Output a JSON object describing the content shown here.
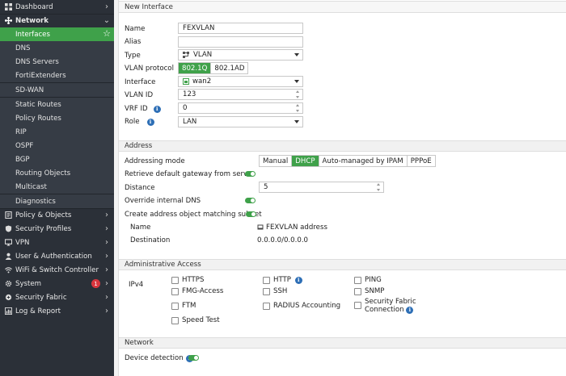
{
  "sidebar": {
    "top_items": [
      {
        "label": "Dashboard",
        "icon": "dashboard-icon"
      },
      {
        "label": "Network",
        "icon": "network-icon"
      }
    ],
    "network_sub": [
      "Interfaces",
      "DNS",
      "DNS Servers",
      "FortiExtenders",
      "SD-WAN",
      "Static Routes",
      "Policy Routes",
      "RIP",
      "OSPF",
      "BGP",
      "Routing Objects",
      "Multicast",
      "Diagnostics"
    ],
    "bottom_items": [
      {
        "label": "Policy & Objects",
        "icon": "policy-icon"
      },
      {
        "label": "Security Profiles",
        "icon": "shield-icon"
      },
      {
        "label": "VPN",
        "icon": "vpn-icon"
      },
      {
        "label": "User & Authentication",
        "icon": "user-icon"
      },
      {
        "label": "WiFi & Switch Controller",
        "icon": "wifi-icon"
      },
      {
        "label": "System",
        "icon": "gear-icon",
        "badge": "1"
      },
      {
        "label": "Security Fabric",
        "icon": "fabric-icon"
      },
      {
        "label": "Log & Report",
        "icon": "chart-icon"
      }
    ]
  },
  "main": {
    "title": "New Interface",
    "name_label": "Name",
    "name_value": "FEXVLAN",
    "alias_label": "Alias",
    "alias_value": "",
    "type_label": "Type",
    "type_value": "VLAN",
    "vlan_protocol_label": "VLAN protocol",
    "vlan_protocol_options": [
      "802.1Q",
      "802.1AD"
    ],
    "interface_label": "Interface",
    "interface_value": "wan2",
    "vlan_id_label": "VLAN ID",
    "vlan_id_value": "123",
    "vrf_id_label": "VRF ID",
    "vrf_id_value": "0",
    "role_label": "Role",
    "role_value": "LAN",
    "address_section": "Address",
    "addressing_mode_label": "Addressing mode",
    "addressing_modes": [
      "Manual",
      "DHCP",
      "Auto-managed by IPAM",
      "PPPoE"
    ],
    "retrieve_gw_label": "Retrieve default gateway from server",
    "distance_label": "Distance",
    "distance_value": "5",
    "override_dns_label": "Override internal DNS",
    "create_addr_label": "Create address object matching subnet",
    "addr_name_label": "Name",
    "addr_name_value": "FEXVLAN address",
    "destination_label": "Destination",
    "destination_value": "0.0.0.0/0.0.0.0",
    "admin_section": "Administrative Access",
    "ipv4_label": "IPv4",
    "access": {
      "https": "HTTPS",
      "http": "HTTP",
      "ping": "PING",
      "fmg": "FMG-Access",
      "ssh": "SSH",
      "snmp": "SNMP",
      "ftm": "FTM",
      "radius": "RADIUS Accounting",
      "fabric1": "Security Fabric",
      "fabric2": "Connection",
      "speedtest": "Speed Test"
    },
    "network_section": "Network",
    "device_detection_label": "Device detection"
  },
  "colors": {
    "accent": "#3fa14a",
    "sidebar_bg": "#2b3038",
    "info": "#2e6fb6",
    "badge": "#d9363e"
  }
}
